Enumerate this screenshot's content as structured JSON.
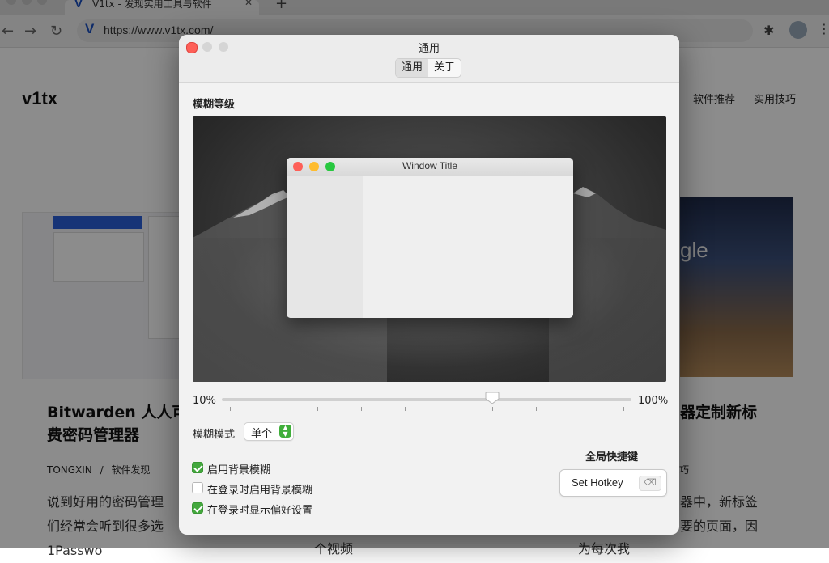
{
  "browser": {
    "tab_title": "V1tx - 发现实用工具与软件",
    "tab_logo": "V",
    "close_glyph": "✕",
    "new_tab_glyph": "+",
    "url": "https://www.v1tx.com/"
  },
  "site": {
    "logo": "v1tx",
    "nav": [
      "软件推荐",
      "实用技巧"
    ],
    "articles": [
      {
        "title_line1": "Bitwarden 人人可",
        "title_line2": "费密码管理器",
        "author": "TONGXIN",
        "separator": "/",
        "category": "软件发现",
        "excerpt_line1": "说到好用的密码管理",
        "excerpt_line2": "们经常会听到很多选",
        "excerpt_line3": "1Passwo"
      },
      {
        "title_line1": "器定制新标",
        "meta_fragment": "巧",
        "excerpt_line1": "器中，新标签",
        "excerpt_line2": "要的页面，因",
        "excerpt_line3": "为每次我"
      }
    ],
    "center_fragment": "个视频"
  },
  "prefs": {
    "window_title": "通用",
    "tabs": [
      {
        "label": "通用",
        "active": true
      },
      {
        "label": "关于",
        "active": false
      }
    ],
    "blur_section_label": "模糊等级",
    "preview_window_title": "Window Title",
    "slider": {
      "min_label": "10%",
      "max_label": "100%",
      "value_fraction": 0.66,
      "tick_count": 10
    },
    "blur_mode_label": "模糊模式",
    "blur_mode_value": "单个",
    "checkboxes": [
      {
        "label": "启用背景模糊",
        "checked": true
      },
      {
        "label": "在登录时启用背景模糊",
        "checked": false
      },
      {
        "label": "在登录时显示偏好设置",
        "checked": true
      }
    ],
    "hotkey_section_label": "全局快捷键",
    "hotkey_button_label": "Set Hotkey",
    "hotkey_clear_glyph": "⌫"
  },
  "colors": {
    "accent_green": "#43a83d",
    "close_red": "#fe5f57",
    "minimize_yellow": "#febc2e",
    "zoom_green": "#28c840"
  },
  "icons": {
    "back": "arrow-left-icon",
    "forward": "arrow-right-icon",
    "reload": "reload-icon",
    "extensions": "puzzle-icon",
    "menu": "more-vertical-icon"
  }
}
